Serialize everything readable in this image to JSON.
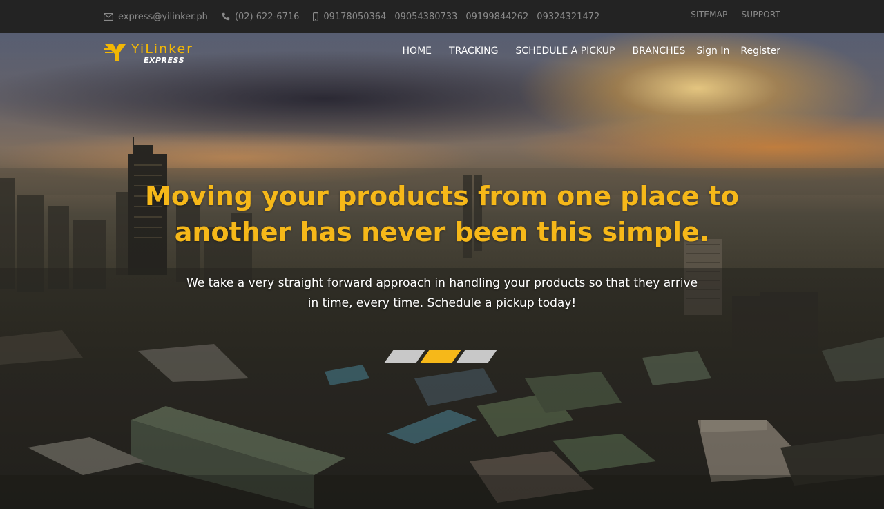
{
  "topbar": {
    "email": "express@yilinker.ph",
    "landline": "(02) 622-6716",
    "mobiles": [
      "09178050364",
      "09054380733",
      "09199844262",
      "09324321472"
    ],
    "links": {
      "sitemap": "SITEMAP",
      "support": "SUPPORT"
    }
  },
  "logo": {
    "brand": "YiLinker",
    "sub": "EXPRESS"
  },
  "nav": {
    "items": [
      "HOME",
      "TRACKING",
      "SCHEDULE A PICKUP",
      "BRANCHES"
    ],
    "sign_in": "Sign In",
    "register": "Register"
  },
  "hero": {
    "headline_line1": "Moving your products from one place to",
    "headline_line2": "another has never been this simple.",
    "subline": "We take a very straight forward approach in handling your products so that they arrive in time, every time. Schedule a pickup today!",
    "slides": 3,
    "active_slide": 2
  },
  "colors": {
    "accent": "#f6b819",
    "topbar": "#232323",
    "topbar_text": "#8a8a8a"
  }
}
